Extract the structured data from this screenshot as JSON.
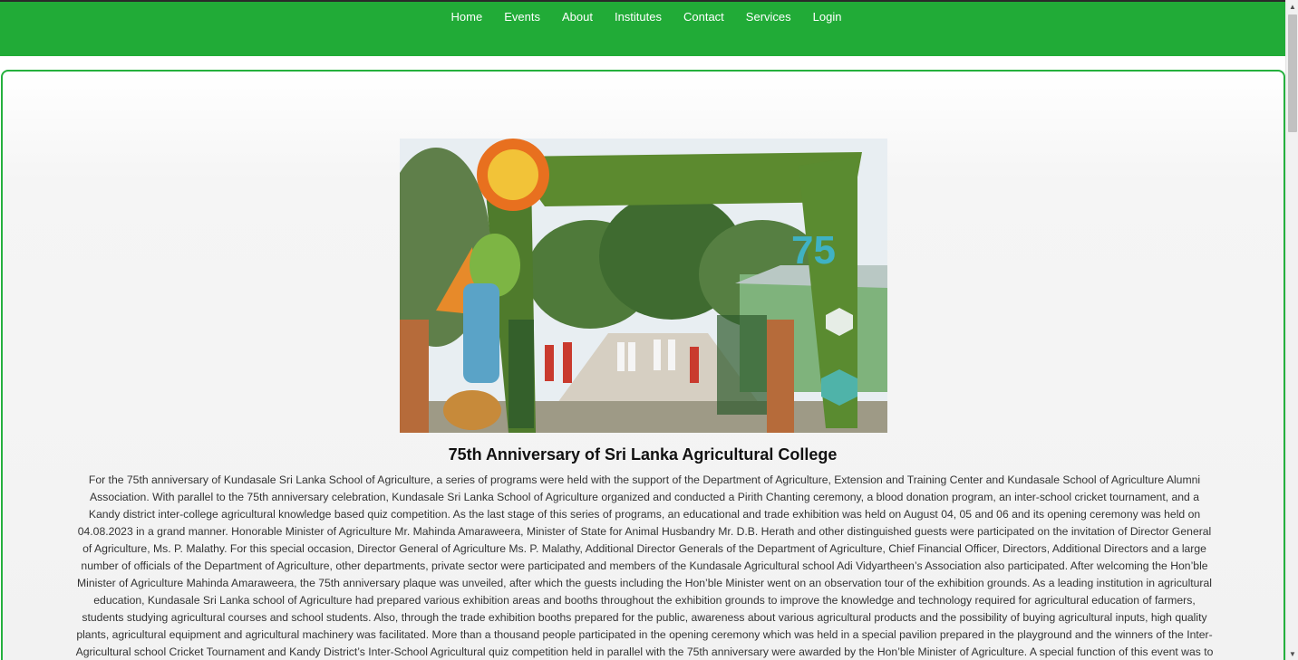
{
  "nav": {
    "items": [
      "Home",
      "Events",
      "About",
      "Institutes",
      "Contact",
      "Services",
      "Login"
    ]
  },
  "article": {
    "title": "75th Anniversary of Sri Lanka Agricultural College",
    "body": "For the 75th anniversary of Kundasale Sri Lanka School of Agriculture, a series of programs were held with the support of the Department of Agriculture, Extension and Training Center and Kundasale School of Agriculture Alumni Association. With parallel to the 75th anniversary celebration, Kundasale Sri Lanka School of Agriculture organized and conducted a Pirith Chanting ceremony, a blood donation program, an inter-school cricket tournament, and a Kandy district inter-college agricultural knowledge based quiz competition. As the last stage of this series of programs, an educational and trade exhibition was held on August 04, 05 and 06 and its opening ceremony was held on 04.08.2023 in a grand manner. Honorable Minister of Agriculture Mr. Mahinda Amaraweera, Minister of State for Animal Husbandry Mr. D.B. Herath and other distinguished guests were participated on the invitation of Director General of Agriculture, Ms. P. Malathy. For this special occasion, Director General of Agriculture Ms. P. Malathy, Additional Director Generals of the Department of Agriculture, Chief Financial Officer, Directors, Additional Directors and a large number of officials of the Department of Agriculture, other departments, private sector were participated and members of the Kundasale Agricultural school Adi Vidyartheen’s Association also participated. After welcoming the Hon’ble Minister of Agriculture Mahinda Amaraweera, the 75th anniversary plaque was unveiled, after which the guests including the Hon’ble Minister went on an observation tour of the exhibition grounds. As a leading institution in agricultural education, Kundasale Sri Lanka school of Agriculture had prepared various exhibition areas and booths throughout the exhibition grounds to improve the knowledge and technology required for agricultural education of farmers, students studying agricultural courses and school students. Also, through the trade exhibition booths prepared for the public, awareness about various agricultural products and the possibility of buying agricultural inputs, high quality plants, agricultural equipment and agricultural machinery was facilitated. More than a thousand people participated in the opening ceremony which was held in a special pavilion prepared in the playground and the winners of the Inter-Agricultural school Cricket Tournament and Kandy District’s Inter-School Agricultural quiz competition held in parallel with the 75th anniversary were awarded by the Hon’ble Minister of Agriculture. A special function of this event was to organize a teacher’s award for the principals and",
    "image": {
      "arch_number": "75"
    }
  },
  "colors": {
    "navbar": "#21ab37",
    "card_border": "#25b03e"
  },
  "icons": {
    "scroll_up": "triangle-up-icon",
    "scroll_down": "triangle-down-icon"
  }
}
